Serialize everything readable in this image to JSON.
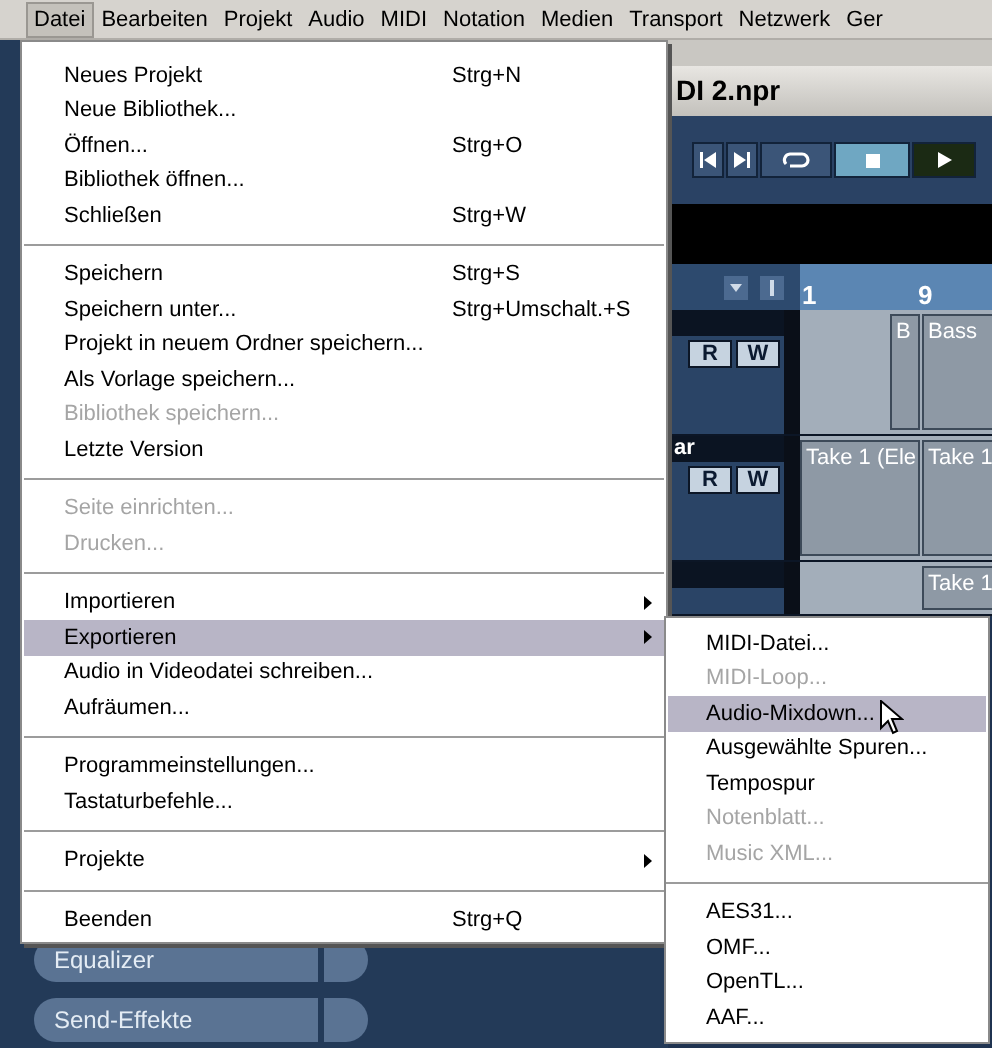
{
  "menu_bar": [
    {
      "label": "Datei",
      "selected": true
    },
    {
      "label": "Bearbeiten",
      "selected": false
    },
    {
      "label": "Projekt",
      "selected": false
    },
    {
      "label": "Audio",
      "selected": false
    },
    {
      "label": "MIDI",
      "selected": false
    },
    {
      "label": "Notation",
      "selected": false
    },
    {
      "label": "Medien",
      "selected": false
    },
    {
      "label": "Transport",
      "selected": false
    },
    {
      "label": "Netzwerk",
      "selected": false
    },
    {
      "label": "Ger",
      "selected": false
    }
  ],
  "file_menu": [
    {
      "kind": "item",
      "label": "Neues Projekt",
      "shortcut": "Strg+N",
      "disabled": false,
      "selected": false,
      "has_submenu": false
    },
    {
      "kind": "item",
      "label": "Neue Bibliothek...",
      "disabled": false,
      "selected": false,
      "has_submenu": false
    },
    {
      "kind": "item",
      "label": "Öffnen...",
      "shortcut": "Strg+O",
      "disabled": false,
      "selected": false,
      "has_submenu": false
    },
    {
      "kind": "item",
      "label": "Bibliothek öffnen...",
      "disabled": false,
      "selected": false,
      "has_submenu": false
    },
    {
      "kind": "item",
      "label": "Schließen",
      "shortcut": "Strg+W",
      "disabled": false,
      "selected": false,
      "has_submenu": false
    },
    {
      "kind": "separator"
    },
    {
      "kind": "item",
      "label": "Speichern",
      "shortcut": "Strg+S",
      "disabled": false,
      "selected": false,
      "has_submenu": false
    },
    {
      "kind": "item",
      "label": "Speichern unter...",
      "shortcut": "Strg+Umschalt.+S",
      "disabled": false,
      "selected": false,
      "has_submenu": false
    },
    {
      "kind": "item",
      "label": "Projekt in neuem Ordner speichern...",
      "disabled": false,
      "selected": false,
      "has_submenu": false
    },
    {
      "kind": "item",
      "label": "Als Vorlage speichern...",
      "disabled": false,
      "selected": false,
      "has_submenu": false
    },
    {
      "kind": "item",
      "label": "Bibliothek speichern...",
      "disabled": true,
      "selected": false,
      "has_submenu": false
    },
    {
      "kind": "item",
      "label": "Letzte Version",
      "disabled": false,
      "selected": false,
      "has_submenu": false
    },
    {
      "kind": "separator"
    },
    {
      "kind": "item",
      "label": "Seite einrichten...",
      "disabled": true,
      "selected": false,
      "has_submenu": false
    },
    {
      "kind": "item",
      "label": "Drucken...",
      "disabled": true,
      "selected": false,
      "has_submenu": false
    },
    {
      "kind": "separator"
    },
    {
      "kind": "item",
      "label": "Importieren",
      "disabled": false,
      "selected": false,
      "has_submenu": true
    },
    {
      "kind": "item",
      "label": "Exportieren",
      "disabled": false,
      "selected": true,
      "has_submenu": true
    },
    {
      "kind": "item",
      "label": "Audio in Videodatei schreiben...",
      "disabled": false,
      "selected": false,
      "has_submenu": false
    },
    {
      "kind": "item",
      "label": "Aufräumen...",
      "disabled": false,
      "selected": false,
      "has_submenu": false
    },
    {
      "kind": "separator"
    },
    {
      "kind": "item",
      "label": "Programmeinstellungen...",
      "disabled": false,
      "selected": false,
      "has_submenu": false
    },
    {
      "kind": "item",
      "label": "Tastaturbefehle...",
      "disabled": false,
      "selected": false,
      "has_submenu": false
    },
    {
      "kind": "separator"
    },
    {
      "kind": "item",
      "label": "Projekte",
      "disabled": false,
      "selected": false,
      "has_submenu": true
    },
    {
      "kind": "separator"
    },
    {
      "kind": "item",
      "label": "Beenden",
      "shortcut": "Strg+Q",
      "disabled": false,
      "selected": false,
      "has_submenu": false
    }
  ],
  "export_submenu": [
    {
      "kind": "item",
      "label": "MIDI-Datei...",
      "disabled": false,
      "selected": false
    },
    {
      "kind": "item",
      "label": "MIDI-Loop...",
      "disabled": true,
      "selected": false
    },
    {
      "kind": "item",
      "label": "Audio-Mixdown...",
      "disabled": false,
      "selected": true
    },
    {
      "kind": "item",
      "label": "Ausgewählte Spuren...",
      "disabled": false,
      "selected": false
    },
    {
      "kind": "item",
      "label": "Tempospur",
      "disabled": false,
      "selected": false
    },
    {
      "kind": "item",
      "label": "Notenblatt...",
      "disabled": true,
      "selected": false
    },
    {
      "kind": "item",
      "label": "Music XML...",
      "disabled": true,
      "selected": false
    },
    {
      "kind": "separator"
    },
    {
      "kind": "item",
      "label": "AES31...",
      "disabled": false,
      "selected": false
    },
    {
      "kind": "item",
      "label": "OMF...",
      "disabled": false,
      "selected": false
    },
    {
      "kind": "item",
      "label": "OpenTL...",
      "disabled": false,
      "selected": false
    },
    {
      "kind": "item",
      "label": "AAF...",
      "disabled": false,
      "selected": false
    }
  ],
  "project_window": {
    "title": "DI 2.npr",
    "ruler": [
      "1",
      "9"
    ],
    "tracks": [
      {
        "record_label": "R",
        "write_label": "W",
        "events": [
          {
            "label": "B"
          },
          {
            "label": "Bass"
          }
        ]
      },
      {
        "name": "ar",
        "record_label": "R",
        "write_label": "W",
        "events": [
          {
            "label": "Take 1 (Ele"
          },
          {
            "label": "Take 1"
          }
        ]
      },
      {
        "events": [
          {
            "label": "Take 1"
          }
        ]
      }
    ]
  },
  "inspector": {
    "sections": [
      "Equalizer",
      "Send-Effekte"
    ]
  }
}
